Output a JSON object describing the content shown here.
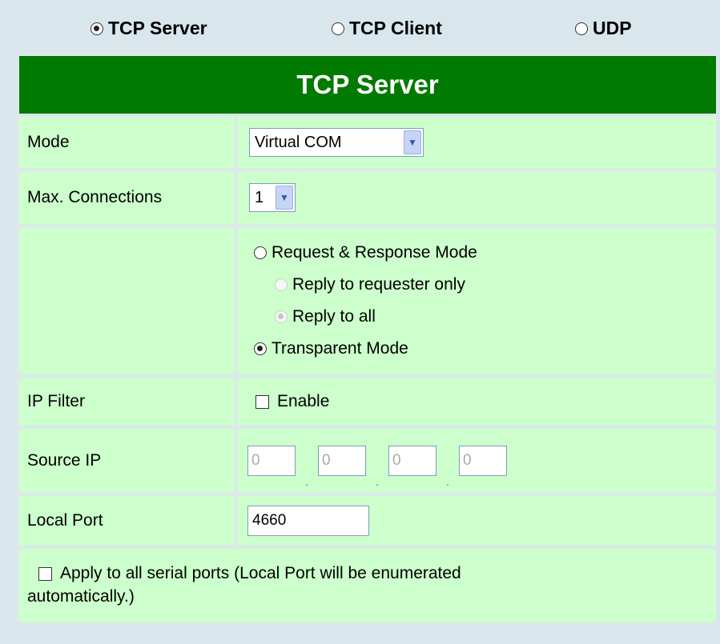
{
  "mode_tabs": [
    {
      "label": "TCP Server",
      "selected": true
    },
    {
      "label": "TCP Client",
      "selected": false
    },
    {
      "label": "UDP",
      "selected": false
    }
  ],
  "header": {
    "title": "TCP Server"
  },
  "mode": {
    "label": "Mode",
    "value": "Virtual COM"
  },
  "max_connections": {
    "label": "Max. Connections",
    "value": "1"
  },
  "response": {
    "request_response_label": "Request & Response Mode",
    "reply_requester_label": "Reply to requester only",
    "reply_all_label": "Reply to all",
    "transparent_label": "Transparent Mode"
  },
  "ip_filter": {
    "label": "IP Filter",
    "enable_label": "Enable",
    "checked": false
  },
  "source_ip": {
    "label": "Source IP",
    "octets": [
      "0",
      "0",
      "0",
      "0"
    ]
  },
  "local_port": {
    "label": "Local Port",
    "value": "4660"
  },
  "apply_all": {
    "label_line1": "Apply to all serial ports (Local Port will be enumerated",
    "label_line2": "automatically.)",
    "checked": false
  },
  "colors": {
    "header_bg": "#007a00",
    "row_bg": "#ccffcc",
    "page_bg": "#d9e6ec"
  }
}
